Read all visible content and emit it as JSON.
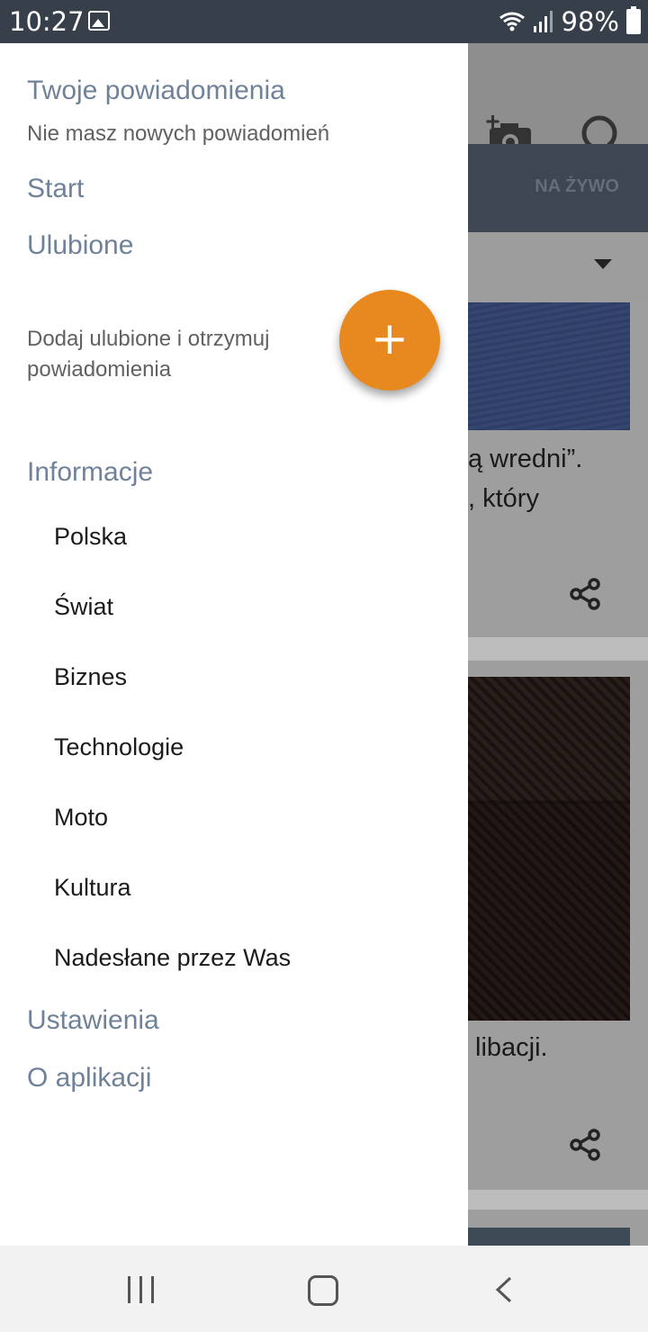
{
  "status_bar": {
    "time": "10:27",
    "battery": "98%"
  },
  "background": {
    "tab_live": "NA ŻYWO",
    "card1_line1": "ą wredni”.",
    "card1_line2": ", który",
    "card2_line1": "libacji."
  },
  "drawer": {
    "notifications_title": "Twoje powiadomienia",
    "notifications_empty": "Nie masz nowych powiadomień",
    "start": "Start",
    "favorites": "Ulubione",
    "favorites_hint_line1": "Dodaj ulubione i otrzymuj",
    "favorites_hint_line2": "powiadomienia",
    "fab_label": "+",
    "info_title": "Informacje",
    "info_items": [
      "Polska",
      "Świat",
      "Biznes",
      "Technologie",
      "Moto",
      "Kultura",
      "Nadesłane przez Was"
    ],
    "settings": "Ustawienia",
    "about": "O aplikacji"
  },
  "colors": {
    "accent": "#e88920",
    "section": "#70829a",
    "status_bar": "#37404a"
  }
}
